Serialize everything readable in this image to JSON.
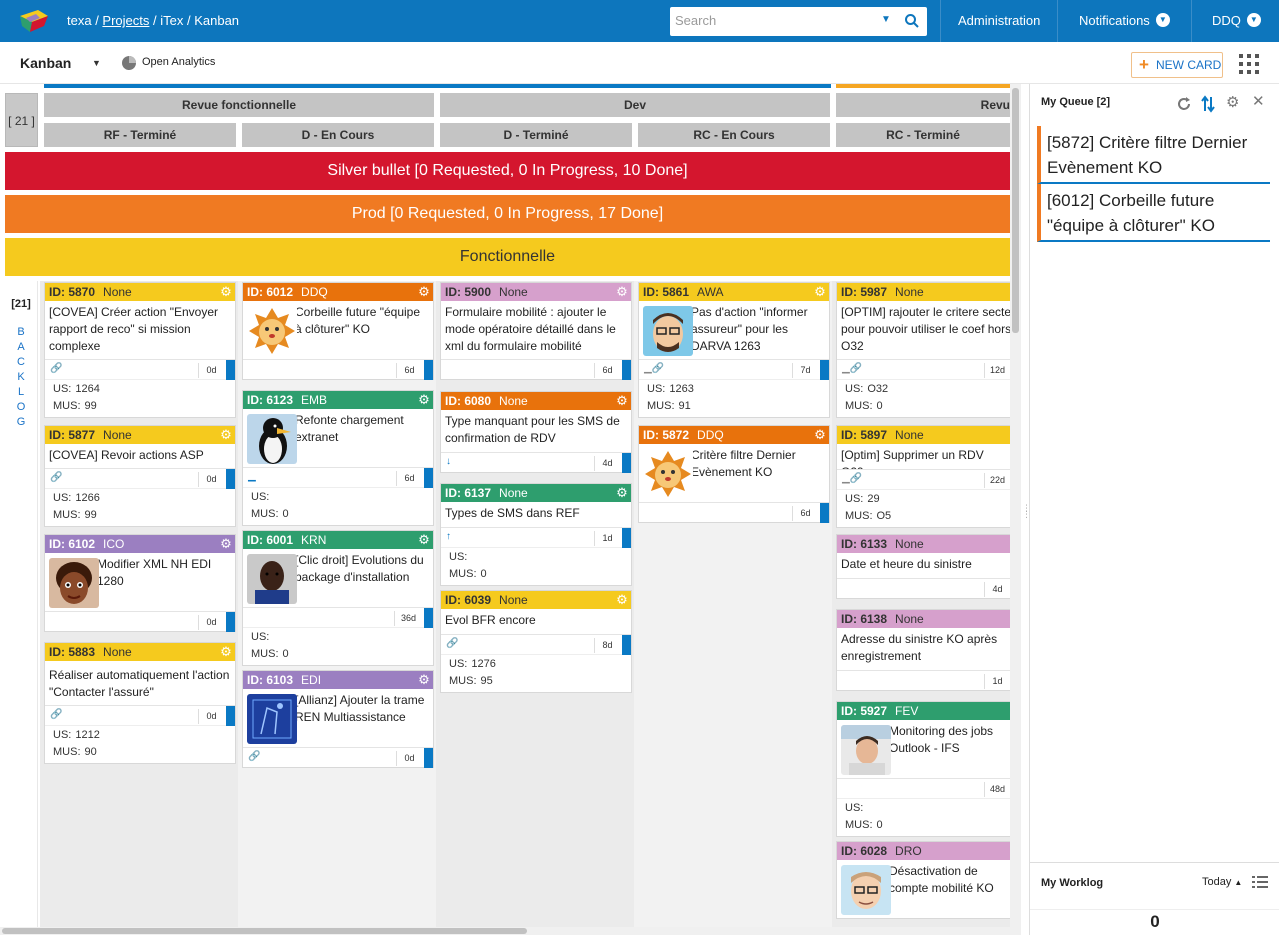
{
  "header": {
    "breadcrumb": {
      "org": "texa",
      "sep1": " / ",
      "projects": "Projects",
      "sep2": " / ",
      "project": "iTex",
      "sep3": " / ",
      "page": "Kanban"
    },
    "search_placeholder": "Search",
    "nav": {
      "administration": "Administration",
      "notifications": "Notifications",
      "user": "DDQ"
    },
    "colors": {
      "brand": "#0d76bd"
    }
  },
  "toolbar": {
    "board_name": "Kanban",
    "analytics": "Open Analytics",
    "new_card": "NEW CARD"
  },
  "board": {
    "header_count": "[ 21 ]",
    "groups": [
      "Revue fonctionnelle",
      "Dev",
      "Revu"
    ],
    "columns": [
      "RF - Terminé",
      "D - En Cours",
      "D - Terminé",
      "RC - En Cours",
      "RC - Terminé"
    ],
    "swimlanes": [
      {
        "label": "Silver bullet [0 Requested, 0 In Progress, 10 Done]",
        "color": "#d4162e"
      },
      {
        "label": "Prod [0 Requested, 0 In Progress, 17 Done]",
        "color": "#f07a22"
      },
      {
        "label": "Fonctionnelle",
        "color": "#f5ca1e"
      }
    ],
    "backlog": {
      "count": "[21]",
      "letters": [
        "B",
        "A",
        "C",
        "K",
        "L",
        "O",
        "G"
      ]
    },
    "meta_labels": {
      "us": "US:",
      "mus": "MUS:"
    },
    "cards": [
      {
        "id": "ID: 5870",
        "owner": "None",
        "title": "[COVEA] Créer action \"Envoyer rapport de reco\" si mission complexe",
        "days": "0d",
        "us": "1264",
        "mus": "99"
      },
      {
        "id": "ID: 5877",
        "owner": "None",
        "title": "[COVEA] Revoir actions ASP",
        "days": "0d",
        "us": "1266",
        "mus": "99"
      },
      {
        "id": "ID: 6102",
        "owner": "ICO",
        "title": "Modifier XML NH EDI 1280",
        "days": "0d"
      },
      {
        "id": "ID: 5883",
        "owner": "None",
        "title": "Réaliser automatiquement l'action \"Contacter l'assuré\"",
        "days": "0d",
        "us": "1212",
        "mus": "90"
      },
      {
        "id": "ID: 6012",
        "owner": "DDQ",
        "title": "Corbeille future \"équipe à clôturer\" KO",
        "days": "6d"
      },
      {
        "id": "ID: 6123",
        "owner": "EMB",
        "title": "Refonte chargement extranet",
        "days": "6d",
        "us": "",
        "mus": "0"
      },
      {
        "id": "ID: 6001",
        "owner": "KRN",
        "title": "[Clic droit] Evolutions du package d'installation",
        "days": "36d",
        "us": "",
        "mus": "0"
      },
      {
        "id": "ID: 6103",
        "owner": "EDI",
        "title": "[Allianz] Ajouter la trame REN Multiassistance",
        "days": "0d"
      },
      {
        "id": "ID: 5900",
        "owner": "None",
        "title": "Formulaire mobilité : ajouter le mode opératoire détaillé dans le xml du formulaire mobilité",
        "days": "6d"
      },
      {
        "id": "ID: 6080",
        "owner": "None",
        "title": "Type manquant pour les SMS de confirmation de RDV",
        "days": "4d"
      },
      {
        "id": "ID: 6137",
        "owner": "None",
        "title": "Types de SMS dans REF",
        "days": "1d",
        "us": "",
        "mus": "0"
      },
      {
        "id": "ID: 6039",
        "owner": "None",
        "title": "Evol BFR encore",
        "days": "8d",
        "us": "1276",
        "mus": "95"
      },
      {
        "id": "ID: 5861",
        "owner": "AWA",
        "title": "Pas d'action \"informer assureur\" pour les DARVA 1263",
        "days": "7d",
        "us": "1263",
        "mus": "91"
      },
      {
        "id": "ID: 5872",
        "owner": "DDQ",
        "title": "Critère filtre Dernier Evènement KO",
        "days": "6d"
      },
      {
        "id": "ID: 5987",
        "owner": "None",
        "title": "[OPTIM] rajouter le critere secteur pour pouvoir utiliser le coef hors zone O32",
        "days": "12d",
        "us": "O32",
        "mus": "0"
      },
      {
        "id": "ID: 5897",
        "owner": "None",
        "title": "[Optim] Supprimer un RDV O29",
        "days": "22d",
        "us": "29",
        "mus": "O5"
      },
      {
        "id": "ID: 6133",
        "owner": "None",
        "title": "Date et heure du sinistre",
        "days": "4d"
      },
      {
        "id": "ID: 6138",
        "owner": "None",
        "title": "Adresse du sinistre KO après enregistrement",
        "days": "1d"
      },
      {
        "id": "ID: 5927",
        "owner": "FEV",
        "title": "Monitoring des jobs Outlook - IFS",
        "days": "48d",
        "us": "",
        "mus": "0"
      },
      {
        "id": "ID: 6028",
        "owner": "DRO",
        "title": "Désactivation de compte mobilité KO",
        "days": ""
      }
    ],
    "card_colors": {
      "yellow": "#f5ca1e",
      "orange": "#e8720c",
      "green": "#2e9e6e",
      "purple": "#9b7fc1",
      "pink": "#d6a0cc",
      "blue": "#0a79c4"
    }
  },
  "queue": {
    "title": "My Queue [2]",
    "items": [
      "[5872] Critère filtre Dernier Evènement KO",
      "[6012] Corbeille future \"équipe à clôturer\" KO"
    ],
    "worklog_title": "My Worklog",
    "worklog_period": "Today",
    "worklog_total": "0"
  }
}
